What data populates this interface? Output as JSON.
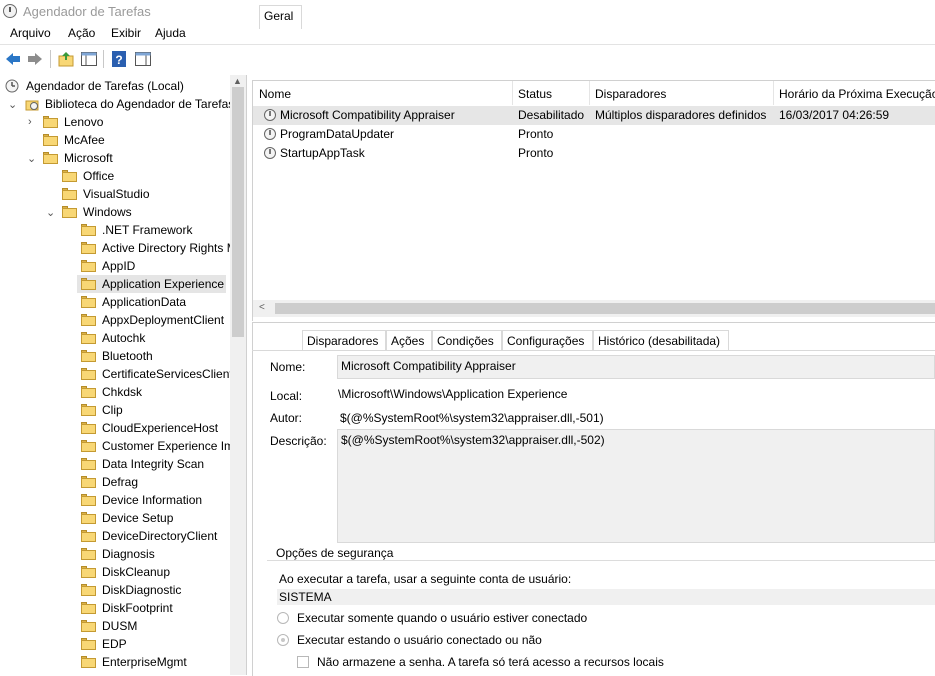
{
  "window": {
    "title": "Agendador de Tarefas"
  },
  "menu": [
    "Arquivo",
    "Ação",
    "Exibir",
    "Ajuda"
  ],
  "toolbar": [
    "back-arrow-icon",
    "forward-arrow-icon",
    "up-folder-icon",
    "show-hide-pane-icon",
    "help-icon",
    "action-pane-icon"
  ],
  "tree": {
    "root": "Agendador de Tarefas (Local)",
    "library": "Biblioteca do Agendador de Tarefas",
    "lenovo": "Lenovo",
    "mcafee": "McAfee",
    "microsoft": "Microsoft",
    "office": "Office",
    "visualstudio": "VisualStudio",
    "windows": "Windows",
    "windows_children": [
      ".NET Framework",
      "Active Directory Rights M",
      "AppID",
      "Application Experience",
      "ApplicationData",
      "AppxDeploymentClient",
      "Autochk",
      "Bluetooth",
      "CertificateServicesClient",
      "Chkdsk",
      "Clip",
      "CloudExperienceHost",
      "Customer Experience Im",
      "Data Integrity Scan",
      "Defrag",
      "Device Information",
      "Device Setup",
      "DeviceDirectoryClient",
      "Diagnosis",
      "DiskCleanup",
      "DiskDiagnostic",
      "DiskFootprint",
      "DUSM",
      "EDP",
      "EnterpriseMgmt"
    ],
    "selected": "Application Experience"
  },
  "list": {
    "columns": [
      "Nome",
      "Status",
      "Disparadores",
      "Horário da Próxima Execução"
    ],
    "rows": [
      {
        "name": "Microsoft Compatibility Appraiser",
        "status": "Desabilitado",
        "triggers": "Múltiplos disparadores definidos",
        "next": "16/03/2017 04:26:59"
      },
      {
        "name": "ProgramDataUpdater",
        "status": "Pronto",
        "triggers": "",
        "next": ""
      },
      {
        "name": "StartupAppTask",
        "status": "Pronto",
        "triggers": "",
        "next": ""
      }
    ]
  },
  "details": {
    "tabs": [
      "Geral",
      "Disparadores",
      "Ações",
      "Condições",
      "Configurações",
      "Histórico (desabilitada)"
    ],
    "active_tab": "Geral",
    "name_label": "Nome:",
    "name_value": "Microsoft Compatibility Appraiser",
    "location_label": "Local:",
    "location_value": "\\Microsoft\\Windows\\Application Experience",
    "author_label": "Autor:",
    "author_value": "$(@%SystemRoot%\\system32\\appraiser.dll,-501)",
    "description_label": "Descrição:",
    "description_value": "$(@%SystemRoot%\\system32\\appraiser.dll,-502)",
    "security": {
      "title": "Opções de segurança",
      "account_prompt": "Ao executar a tarefa, usar a seguinte conta de usuário:",
      "account": "SISTEMA",
      "option1": "Executar somente quando o usuário estiver conectado",
      "option2": "Executar estando o usuário conectado ou não",
      "option2_selected": true,
      "nopassword": "Não armazene a senha. A tarefa só terá acesso a recursos locais",
      "nopassword_checked": false
    }
  }
}
